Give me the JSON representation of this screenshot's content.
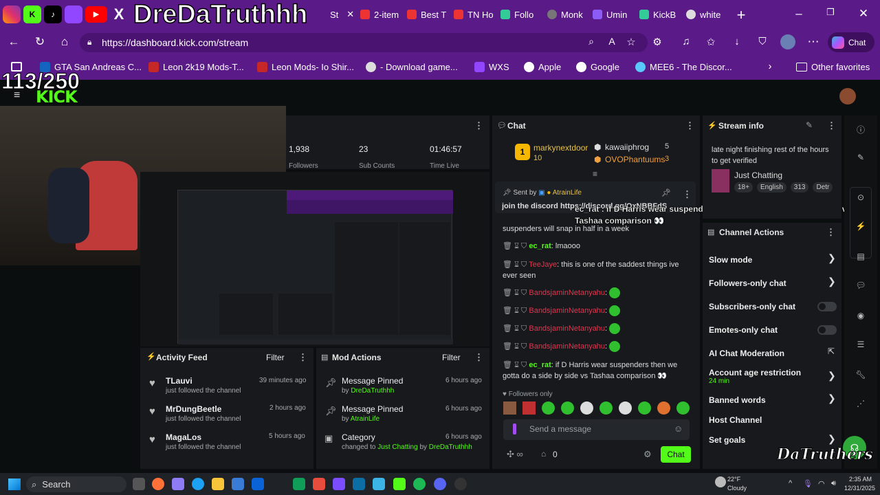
{
  "overlay": {
    "handle": "DreDaTruthhh",
    "counter": "113/250",
    "watermark": "DaTruthers"
  },
  "tabs": [
    {
      "label": "St"
    },
    {
      "label": "2-item"
    },
    {
      "label": "Best T"
    },
    {
      "label": "TN Ho"
    },
    {
      "label": "Follo"
    },
    {
      "label": "Monk"
    },
    {
      "label": "Umin"
    },
    {
      "label": "KickB"
    },
    {
      "label": "white"
    }
  ],
  "address": {
    "url": "https://dashboard.kick.com/stream",
    "chat_button": "Chat"
  },
  "favorites": {
    "items": [
      "GTA San Andreas C...",
      "Leon 2k19 Mods-T...",
      "Leon Mods- Io Shir...",
      "- Download game...",
      "WXS",
      "Apple",
      "Google",
      "MEE6 - The Discor..."
    ],
    "other": "Other favorites"
  },
  "stats": {
    "followers_value": "1,938",
    "followers_label": "Followers",
    "subs_value": "23",
    "subs_label": "Sub Counts",
    "time_value": "01:46:57",
    "time_label": "Time Live"
  },
  "activity": {
    "title": "Activity Feed",
    "filter": "Filter",
    "items": [
      {
        "name": "TLauvi",
        "action": "just followed the channel",
        "time": "39 minutes ago"
      },
      {
        "name": "MrDungBeetle",
        "action": "just followed the channel",
        "time": "2 hours ago"
      },
      {
        "name": "MagaLos",
        "action": "just followed the channel",
        "time": "5 hours ago"
      }
    ]
  },
  "mod": {
    "title": "Mod Actions",
    "filter": "Filter",
    "items": [
      {
        "title": "Message Pinned",
        "by": "by",
        "user": "DreDaTruthhh",
        "time": "6 hours ago"
      },
      {
        "title": "Message Pinned",
        "by": "by",
        "user": "AtrainLife",
        "time": "6 hours ago"
      },
      {
        "title": "Category",
        "prefix": "changed to",
        "category": "Just Chatting",
        "by": "by",
        "user": "DreDaTruthhh",
        "time": "6 hours ago"
      }
    ]
  },
  "chat": {
    "title": "Chat",
    "leaders": [
      {
        "rank": "1",
        "name": "markynextdoor",
        "count": "10"
      },
      {
        "name": "kawaiiphrog",
        "count": "5"
      },
      {
        "name": "OVOPhantuums",
        "count": "3"
      }
    ],
    "pinned": {
      "sent_by": "Sent by",
      "user": "AtrainLife",
      "text": "join the discord https://discord.gg/OxNBBFdS"
    },
    "notice": "ec_rat : if D Harris wear suspenders then we gotta do a side by side vs Tashaa comparison 👀",
    "messages": [
      {
        "user": "",
        "text": "suspenders will snap in half in a week"
      },
      {
        "user": "ec_rat",
        "text": "lmaooo"
      },
      {
        "user": "TeeJaye",
        "text": "this is one of the saddest things ive ever seen"
      },
      {
        "user": "BandsjaminNetanyahu",
        "text": ""
      },
      {
        "user": "BandsjaminNetanyahu",
        "text": ""
      },
      {
        "user": "BandsjaminNetanyahu",
        "text": ""
      },
      {
        "user": "BandsjaminNetanyahu",
        "text": ""
      },
      {
        "user": "ec_rat",
        "text": "if D Harris wear suspenders then we gotta do a side by side vs Tashaa comparison 👀"
      }
    ],
    "followers_only": "Followers only",
    "placeholder": "Send a message",
    "count": "0",
    "send": "Chat"
  },
  "stream_info": {
    "title": "Stream info",
    "stream_title": "late night finishing rest of the hours to get verified",
    "category": "Just Chatting",
    "tags": [
      "18+",
      "English",
      "313",
      "Detr"
    ]
  },
  "channel_actions": {
    "title": "Channel Actions",
    "items": [
      {
        "label": "Slow mode"
      },
      {
        "label": "Followers-only chat"
      },
      {
        "label": "Subscribers-only chat"
      },
      {
        "label": "Emotes-only chat"
      },
      {
        "label": "AI Chat Moderation"
      },
      {
        "label": "Account age restriction",
        "sub": "24 min"
      },
      {
        "label": "Banned words"
      },
      {
        "label": "Host Channel"
      },
      {
        "label": "Set goals"
      }
    ]
  },
  "taskbar": {
    "search": "Search",
    "temp": "22°F",
    "weather": "Cloudy",
    "time": "2:35 AM",
    "date": "12/31/2025"
  },
  "colors": {
    "brand": "#53fc18",
    "browser": "#5a1a87",
    "panel": "#17191c"
  }
}
